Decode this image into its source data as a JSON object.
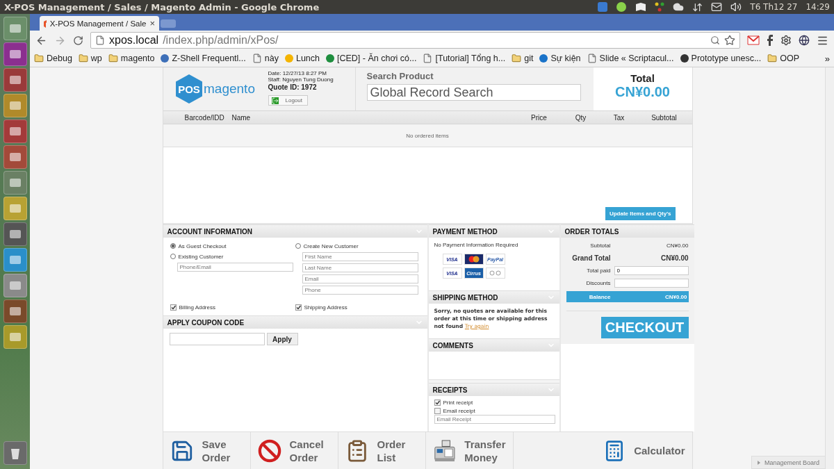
{
  "os_bar": {
    "title": "X-POS Management / Sales / Magento Admin - Google Chrome",
    "date": "T6 Th12 27",
    "time": "14:29"
  },
  "browser": {
    "tab_title": "X-POS Management / Sale",
    "tab_close": "×",
    "url_host": "xpos.local",
    "url_path": "/index.php/admin/xPos/",
    "more": "»",
    "bookmarks": [
      {
        "label": "Debug",
        "kind": "folder"
      },
      {
        "label": "wp",
        "kind": "folder"
      },
      {
        "label": "magento",
        "kind": "folder"
      },
      {
        "label": "Z-Shell Frequentl...",
        "kind": "site",
        "color": "#3d6fb8"
      },
      {
        "label": "này",
        "kind": "page"
      },
      {
        "label": "Lunch",
        "kind": "site",
        "color": "#f4b400"
      },
      {
        "label": "[CED] - Ăn chơi có...",
        "kind": "site",
        "color": "#1e8e3e"
      },
      {
        "label": "[Tutorial] Tổng h...",
        "kind": "page"
      },
      {
        "label": "git",
        "kind": "folder"
      },
      {
        "label": "Sự kiện",
        "kind": "site",
        "color": "#1a73c9"
      },
      {
        "label": "Slide « Scriptacul...",
        "kind": "page"
      },
      {
        "label": "Prototype unesc...",
        "kind": "site",
        "color": "#333333"
      },
      {
        "label": "OOP",
        "kind": "folder"
      }
    ]
  },
  "header": {
    "logo_badge": "POS",
    "logo_text": "magento",
    "date": "Date: 12/27/13 8:27 PM",
    "staff": "Staff: Nguyen Tung Duong",
    "quote": "Quote ID: 1972",
    "logout": "Logout",
    "search_label": "Search Product",
    "search_placeholder": "Global Record Search",
    "total_label": "Total",
    "total_value": "CN¥0.00"
  },
  "table": {
    "columns": [
      "Barcode/IDD",
      "Name",
      "Price",
      "Qty",
      "Tax",
      "Subtotal"
    ],
    "empty": "No ordered items",
    "update_button": "Update Items and Qty's"
  },
  "account": {
    "title": "ACCOUNT INFORMATION",
    "options": [
      {
        "label": "As Guest Checkout",
        "selected": true
      },
      {
        "label": "Existing Customer",
        "selected": false
      },
      {
        "label": "Create New Customer",
        "selected": false
      }
    ],
    "existing_placeholder": "Phone/Email",
    "new_fields": [
      {
        "placeholder": "First Name"
      },
      {
        "placeholder": "Last Name"
      },
      {
        "placeholder": "Email"
      },
      {
        "placeholder": "Phone"
      }
    ],
    "addresses": [
      {
        "label": "Billing Address",
        "checked": true
      },
      {
        "label": "Shipping Address",
        "checked": true
      }
    ]
  },
  "coupon": {
    "title": "APPLY COUPON CODE",
    "button": "Apply"
  },
  "payment": {
    "title": "PAYMENT METHOD",
    "note": "No Payment Information Required",
    "cards": [
      {
        "kind": "visa",
        "label": "VISA"
      },
      {
        "kind": "mastercard"
      },
      {
        "kind": "paypal",
        "label": "PayPal"
      },
      {
        "kind": "visa_electron",
        "label": "VISA"
      },
      {
        "kind": "cirrus",
        "label": "Cirrus"
      },
      {
        "kind": "maestro"
      }
    ]
  },
  "shipping": {
    "title": "SHIPPING METHOD",
    "message": "Sorry, no quotes are available for this order at this time or shipping address not found",
    "link": "Try again"
  },
  "comments": {
    "title": "COMMENTS"
  },
  "receipts": {
    "title": "RECEIPTS",
    "options": [
      {
        "label": "Print receipt",
        "checked": true
      },
      {
        "label": "Email receipt",
        "checked": false
      }
    ],
    "email_placeholder": "Email Receipt"
  },
  "totals": {
    "title": "ORDER TOTALS",
    "subtotal_label": "Subtotal",
    "subtotal": "CN¥0.00",
    "grand_label": "Grand Total",
    "grand": "CN¥0.00",
    "paid_label": "Total paid",
    "paid_value": "0",
    "discount_label": "Discounts",
    "balance_label": "Balance",
    "balance": "CN¥0.00",
    "checkout": "CHECKOUT"
  },
  "actions": [
    {
      "label": "Save Order",
      "kind": "save"
    },
    {
      "label": "Cancel Order",
      "kind": "cancel"
    },
    {
      "label": "Order List",
      "kind": "list"
    },
    {
      "label": "Transfer Money",
      "kind": "register"
    },
    {
      "label": "Calculator",
      "kind": "calculator"
    }
  ],
  "management_board": "Management Board"
}
